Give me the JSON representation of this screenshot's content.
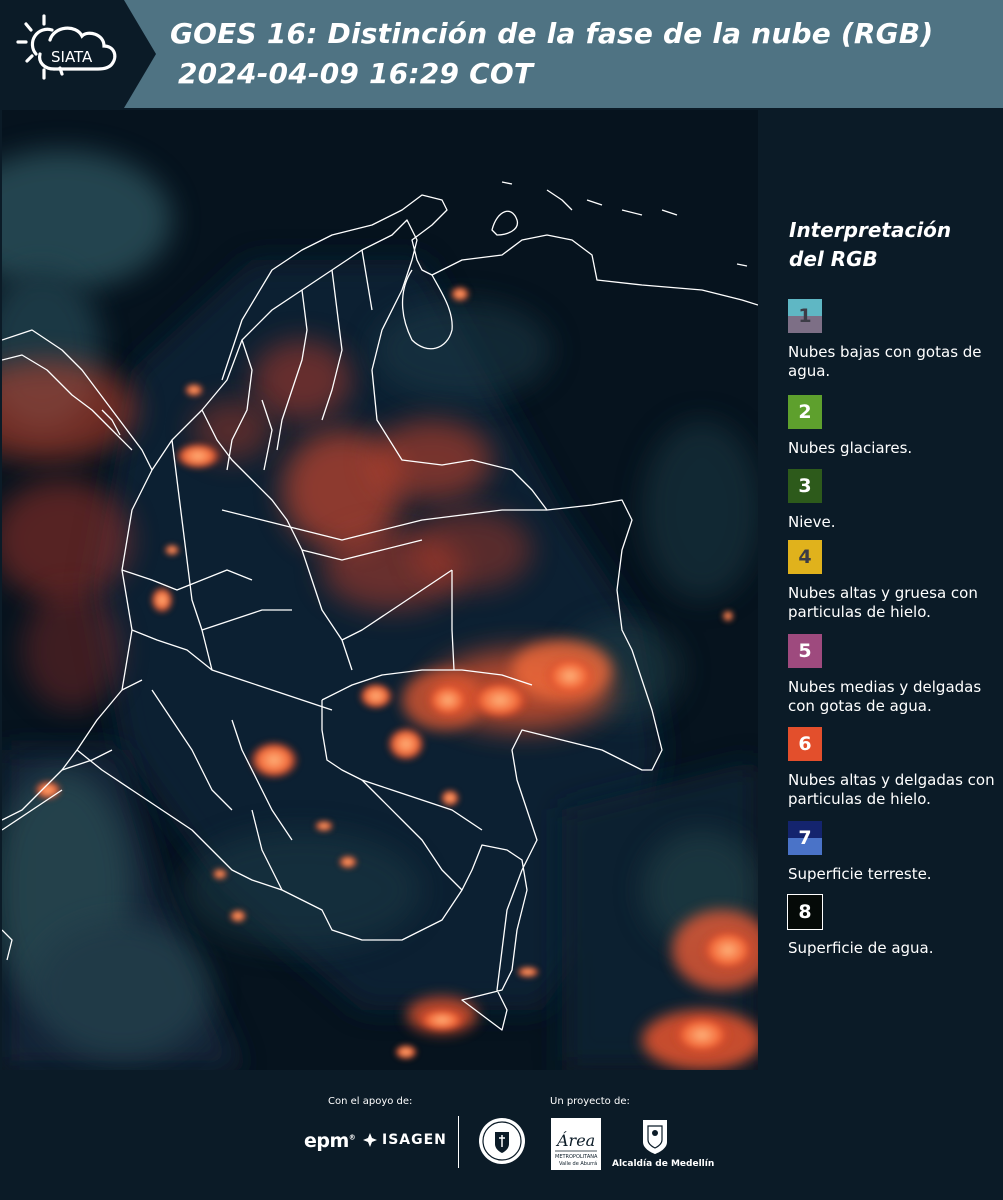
{
  "header": {
    "logo_text": "SIATA",
    "title_line1": "GOES 16: Distinción de la fase de la nube (RGB)",
    "title_line2": "2024-04-09 16:29 COT"
  },
  "legend": {
    "title": "Interpretación del RGB",
    "items": [
      {
        "num": "1",
        "label": "Nubes bajas con gotas de agua.",
        "color_top": "#5fb7c4",
        "color_bottom": "#7d6f86",
        "num_color": "#3c3c46"
      },
      {
        "num": "2",
        "label": "Nubes glaciares.",
        "color_top": "#5ea02d",
        "color_bottom": "#5ea02d",
        "num_color": "#ffffff"
      },
      {
        "num": "3",
        "label": "Nieve.",
        "color_top": "#2d5a1b",
        "color_bottom": "#2d5a1b",
        "num_color": "#ffffff"
      },
      {
        "num": "4",
        "label": "Nubes altas y gruesa con particulas de hielo.",
        "color_top": "#e0b21c",
        "color_bottom": "#e0b21c",
        "num_color": "#3c3c46"
      },
      {
        "num": "5",
        "label": "Nubes medias y delgadas con gotas de agua.",
        "color_top": "#9e4a7e",
        "color_bottom": "#9e4a7e",
        "num_color": "#ffffff"
      },
      {
        "num": "6",
        "label": "Nubes altas y delgadas con particulas de hielo.",
        "color_top": "#e34f2c",
        "color_bottom": "#e34f2c",
        "num_color": "#ffffff"
      },
      {
        "num": "7",
        "label": "Superficie terreste.",
        "color_top": "#14246e",
        "color_bottom": "#4a73c8",
        "num_color": "#ffffff"
      },
      {
        "num": "8",
        "label": "Superficie de agua.",
        "color_top": "#050a08",
        "color_bottom": "#050a08",
        "num_color": "#ffffff",
        "border": "#ffffff"
      }
    ]
  },
  "footer": {
    "support_label": "Con el apoyo de:",
    "project_label": "Un proyecto de:",
    "sponsors": [
      "epm",
      "ISAGEN"
    ],
    "partners": [
      "Área Metropolitana Valle de Aburrá",
      "Alcaldía de Medellín"
    ],
    "amva_logo_text": "Área",
    "amva_sub": "METROPOLITANA",
    "amva_sub2": "Valle de Aburrá",
    "alcaldia_text": "Alcaldía de Medellín"
  },
  "colors": {
    "panel_bg": "#0b1b27",
    "header_bg": "#4f7383",
    "cloud_red": "#e8452c",
    "border_lines": "#ffffff"
  }
}
